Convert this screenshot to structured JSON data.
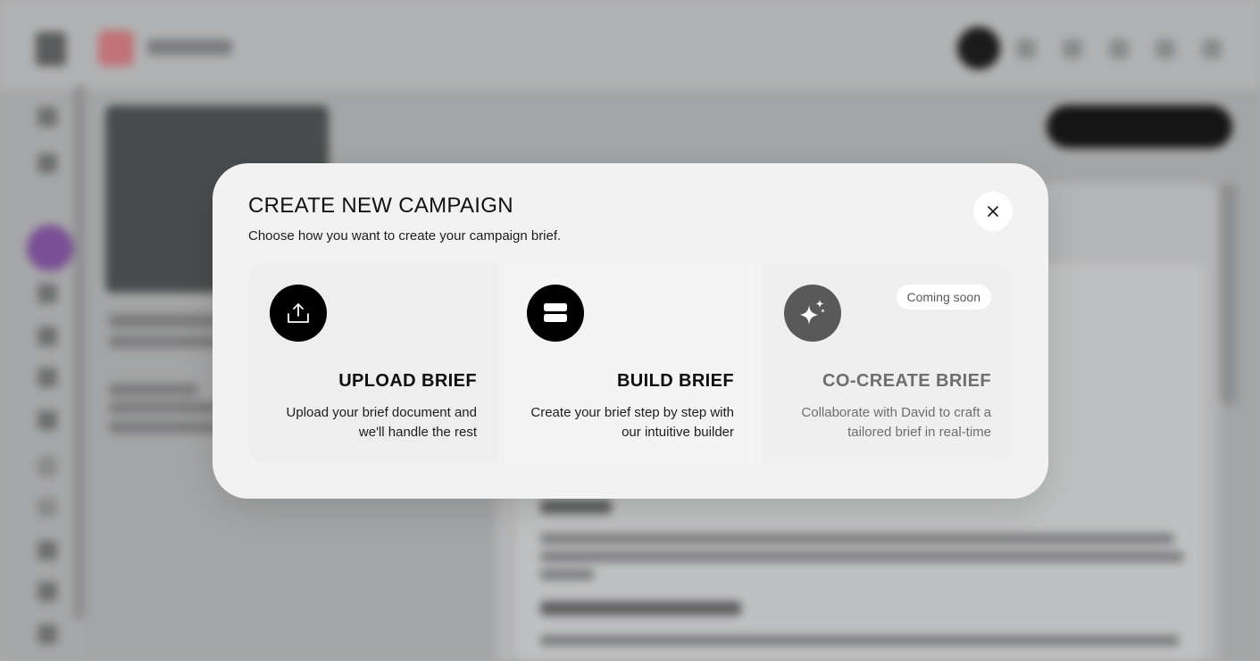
{
  "modal": {
    "title": "CREATE NEW CAMPAIGN",
    "subtitle": "Choose how you want to create your campaign brief.",
    "close_icon": "close-icon"
  },
  "options": [
    {
      "title": "UPLOAD BRIEF",
      "description": "Upload your brief document and we'll handle the rest",
      "icon": "upload-icon"
    },
    {
      "title": "BUILD BRIEF",
      "description": "Create your brief step by step with our intuitive builder",
      "icon": "builder-icon"
    },
    {
      "title": "CO-CREATE BRIEF",
      "description": "Collaborate with David to craft a tailored brief in real-time",
      "icon": "sparkle-icon",
      "badge": "Coming soon"
    }
  ],
  "colors": {
    "modal_bg": "#f2f2f2",
    "icon_bg": "#000000",
    "disabled_icon_bg": "#595959",
    "disabled_text": "#6e6e6e"
  }
}
